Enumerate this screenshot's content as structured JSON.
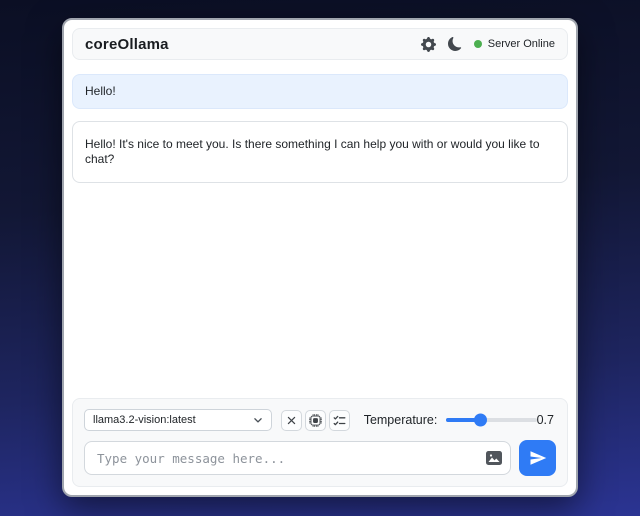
{
  "header": {
    "title": "coreOllama",
    "settings_icon": "gear-icon",
    "theme_icon": "moon-icon",
    "status": {
      "label": "Server Online",
      "color": "#4CAF50"
    }
  },
  "messages": [
    {
      "role": "user",
      "text": "Hello!"
    },
    {
      "role": "assistant",
      "text": "Hello! It's nice to meet you. Is there something I can help you with or would you like to chat?"
    }
  ],
  "controls": {
    "model_selected": "llama3.2-vision:latest",
    "select_chevron_icon": "chevron-down-icon",
    "buttons": [
      {
        "name": "clear-chat",
        "icon": "x-icon"
      },
      {
        "name": "model-details",
        "icon": "cpu-icon"
      },
      {
        "name": "task-options",
        "icon": "checklist-icon"
      }
    ],
    "temperature_label": "Temperature:",
    "temperature_value": "0.7",
    "temperature_percent": 37
  },
  "composer": {
    "placeholder": "Type your message here...",
    "attach_icon": "image-icon",
    "send_icon": "send-icon"
  },
  "colors": {
    "accent_blue": "#2F7BF5",
    "status_green": "#4CAF50",
    "user_bubble_bg": "#E9F2FE",
    "panel_bg": "#F8F9FA"
  }
}
